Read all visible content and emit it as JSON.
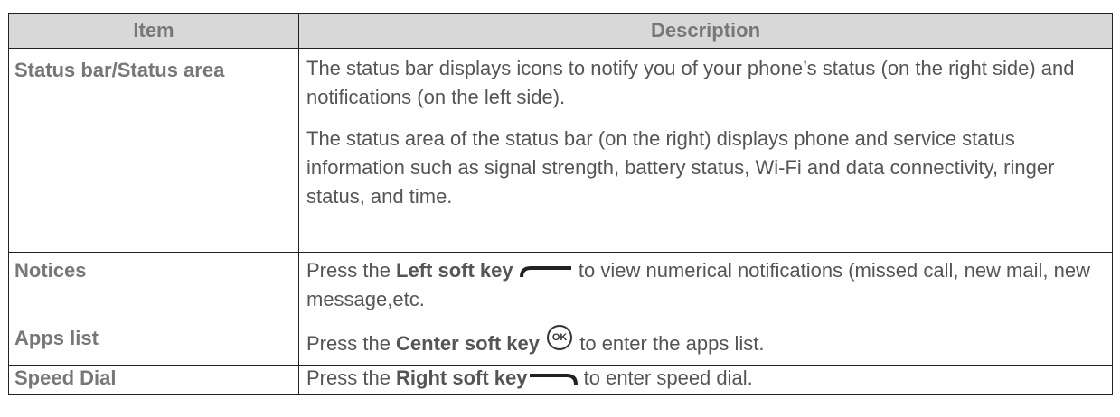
{
  "table": {
    "headers": {
      "item": "Item",
      "description": "Description"
    },
    "rows": [
      {
        "item": "Status bar/Status area",
        "desc_p1": "The status bar displays icons to notify you of your phone’s status (on the right side) and notifications (on the left side).",
        "desc_p2": "The status area of the status bar (on the right) displays phone and service status information such as signal strength, battery status, Wi-Fi and data connectivity, ringer status, and time."
      },
      {
        "item": "Notices",
        "desc_pre": "Press the ",
        "desc_key": "Left soft key",
        "desc_post": " to view numerical notifications (missed call, new mail, new message,etc.",
        "icon": "left-soft-key-icon"
      },
      {
        "item": "Apps list",
        "desc_pre": "Press the ",
        "desc_key": "Center soft key",
        "icon_label": "OK",
        "desc_post": " to enter the apps list.",
        "icon": "ok-key-icon"
      },
      {
        "item": "Speed Dial",
        "desc_pre": "Press the ",
        "desc_key": "Right soft key",
        "desc_post": " to enter speed dial.",
        "icon": "right-soft-key-icon"
      }
    ]
  }
}
